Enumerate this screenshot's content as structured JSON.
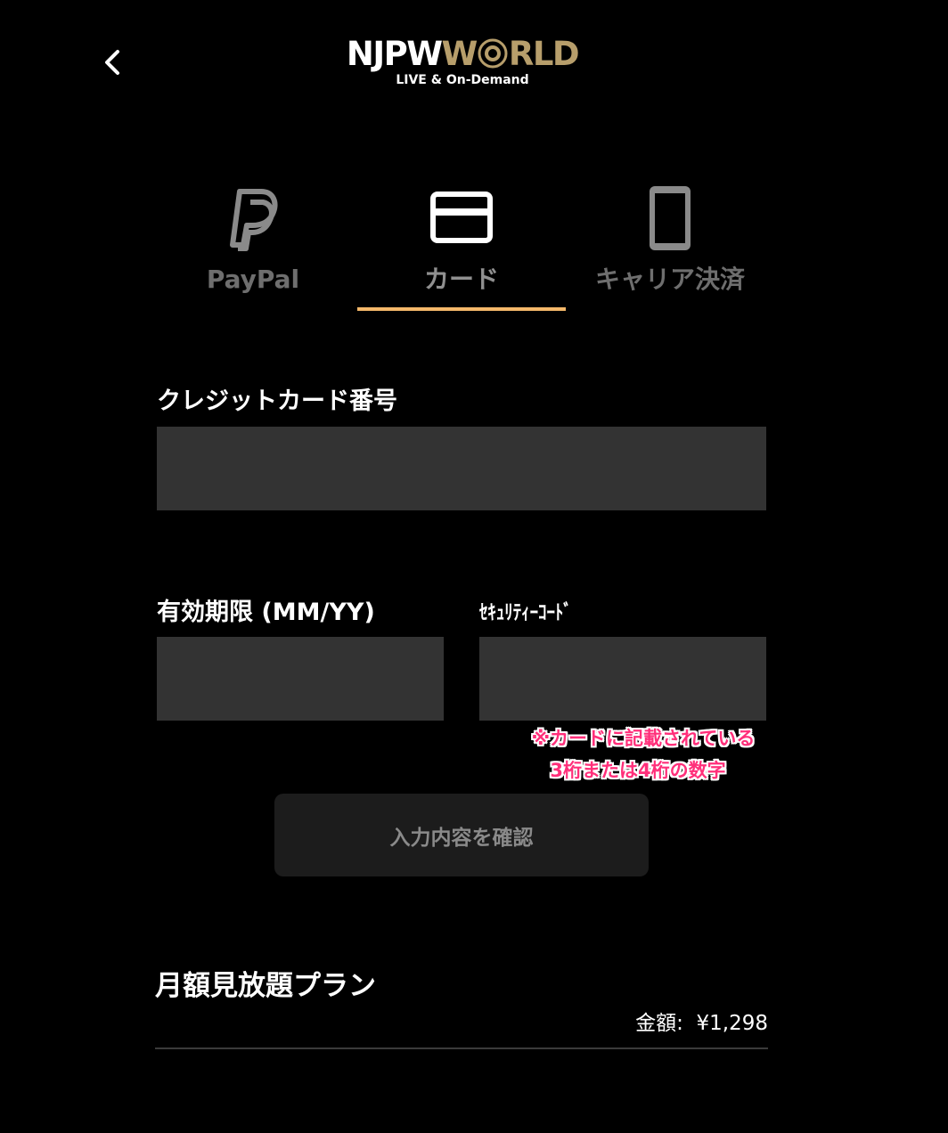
{
  "header": {
    "back_icon": "chevron-left-icon",
    "logo_part1": "NJPW",
    "logo_part2": "W",
    "logo_emblem": "lion-emblem",
    "logo_part3": "RLD",
    "logo_sub": "LIVE & On-Demand",
    "logo_accent": "#b79e6b"
  },
  "tabs": [
    {
      "label": "PayPal",
      "icon": "paypal-icon",
      "active": false
    },
    {
      "label": "カード",
      "icon": "credit-card-icon",
      "active": true
    },
    {
      "label": "キャリア決済",
      "icon": "smartphone-icon",
      "active": false
    }
  ],
  "active_tab_color": "#f4b86a",
  "form": {
    "card_number_label": "クレジットカード番号",
    "card_number_value": "",
    "expiry_label": "有効期限 (MM/YY)",
    "expiry_value": "",
    "security_label": "ｾｷｭﾘﾃｨｰｺｰﾄﾞ",
    "security_value": "",
    "security_note_line1": "※カードに記載されている",
    "security_note_line2": "3桁または4桁の数字",
    "note_color": "#ff2f7a",
    "confirm_label": "入力内容を確認"
  },
  "plan": {
    "title": "月額見放題プラン",
    "price_label": "金額:",
    "price_value": "¥1,298"
  }
}
